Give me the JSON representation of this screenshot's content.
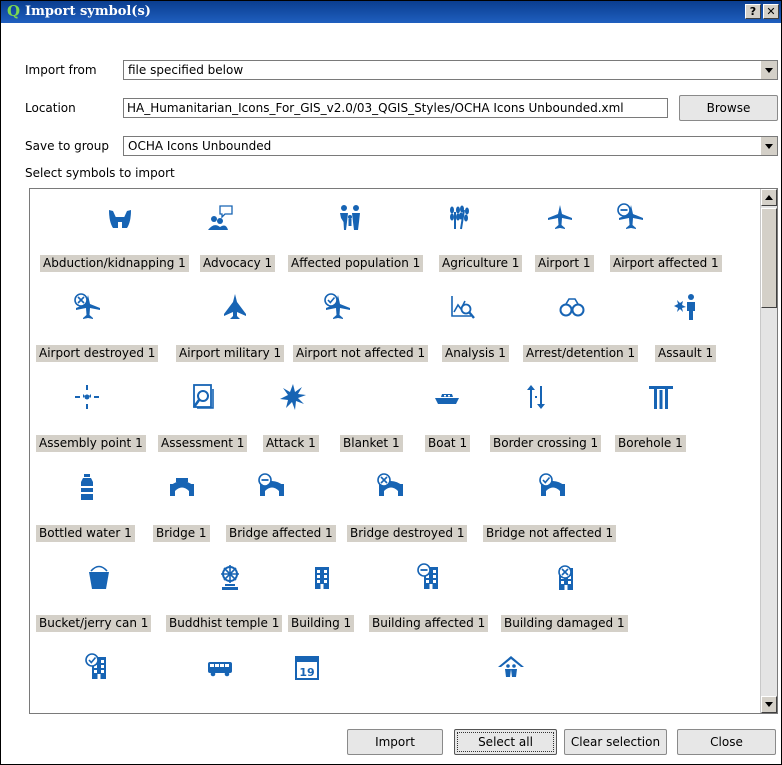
{
  "window": {
    "title": "Import symbol(s)",
    "help_button": "?",
    "close_button": "✕"
  },
  "form": {
    "import_from_label": "Import from",
    "import_from_value": "file specified below",
    "location_label": "Location",
    "location_value": "HA_Humanitarian_Icons_For_GIS_v2.0/03_QGIS_Styles/OCHA Icons Unbounded.xml",
    "browse_label": "Browse",
    "save_to_group_label": "Save to group",
    "save_to_group_value": "OCHA Icons Unbounded",
    "select_symbols_label": "Select symbols to import"
  },
  "accent_color": "#1764b4",
  "symbols": [
    {
      "label": "Abduction/kidnapping 1",
      "icon": "hands-icon"
    },
    {
      "label": "Advocacy 1",
      "icon": "advocacy-icon"
    },
    {
      "label": "Affected population 1",
      "icon": "people-icon"
    },
    {
      "label": "Agriculture 1",
      "icon": "wheat-icon"
    },
    {
      "label": "Airport 1",
      "icon": "plane-icon"
    },
    {
      "label": "Airport affected 1",
      "icon": "plane-affected-icon"
    },
    {
      "label": "Airport destroyed 1",
      "icon": "plane-destroyed-icon"
    },
    {
      "label": "Airport military 1",
      "icon": "military-plane-icon"
    },
    {
      "label": "Airport not affected 1",
      "icon": "plane-not-affected-icon"
    },
    {
      "label": "Analysis 1",
      "icon": "analysis-icon"
    },
    {
      "label": "Arrest/detention 1",
      "icon": "handcuffs-icon"
    },
    {
      "label": "Assault 1",
      "icon": "assault-icon"
    },
    {
      "label": "Assembly point 1",
      "icon": "assembly-point-icon"
    },
    {
      "label": "Assessment 1",
      "icon": "assessment-icon"
    },
    {
      "label": "Attack 1",
      "icon": "attack-icon"
    },
    {
      "label": "Blanket 1",
      "icon": "blanket-icon"
    },
    {
      "label": "Boat 1",
      "icon": "boat-icon"
    },
    {
      "label": "Border crossing 1",
      "icon": "border-crossing-icon"
    },
    {
      "label": "Borehole 1",
      "icon": "borehole-icon"
    },
    {
      "label": "Bottled water 1",
      "icon": "bottle-icon"
    },
    {
      "label": "Bridge 1",
      "icon": "bridge-icon"
    },
    {
      "label": "Bridge affected 1",
      "icon": "bridge-affected-icon"
    },
    {
      "label": "Bridge destroyed 1",
      "icon": "bridge-destroyed-icon"
    },
    {
      "label": "Bridge not affected 1",
      "icon": "bridge-not-affected-icon"
    },
    {
      "label": "Bucket/jerry can 1",
      "icon": "bucket-icon"
    },
    {
      "label": "Buddhist temple 1",
      "icon": "dharma-wheel-icon"
    },
    {
      "label": "Building 1",
      "icon": "building-icon"
    },
    {
      "label": "Building affected 1",
      "icon": "building-affected-icon"
    },
    {
      "label": "Building damaged 1",
      "icon": "building-damaged-icon"
    },
    {
      "label": "",
      "icon": "building-not-affected-icon"
    },
    {
      "label": "",
      "icon": "bus-icon"
    },
    {
      "label": "",
      "icon": "calendar-icon"
    },
    {
      "label": "",
      "icon": "camp-icon"
    }
  ],
  "calendar_day": "19",
  "buttons": {
    "import": "Import",
    "select_all": "Select all",
    "clear_selection": "Clear selection",
    "close": "Close"
  }
}
